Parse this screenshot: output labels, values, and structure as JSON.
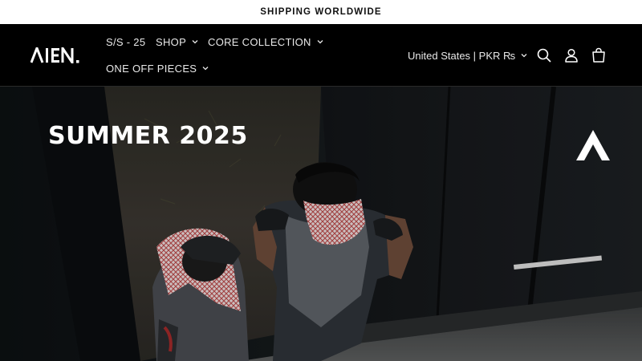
{
  "announcement": {
    "text": "SHIPPING WORLDWIDE"
  },
  "header": {
    "logo_text": "AIEN.",
    "nav": {
      "ss25": "S/S - 25",
      "shop": "SHOP",
      "core": "CORE COLLECTION",
      "one_off": "ONE OFF PIECES"
    },
    "locale": "United States | PKR ₨",
    "icons": [
      "search-icon",
      "account-icon",
      "cart-icon"
    ]
  },
  "hero": {
    "title": "SUMMER 2025"
  },
  "colors": {
    "header_bg": "#000000",
    "announcement_bg": "#ffffff",
    "text": "#ffffff"
  }
}
